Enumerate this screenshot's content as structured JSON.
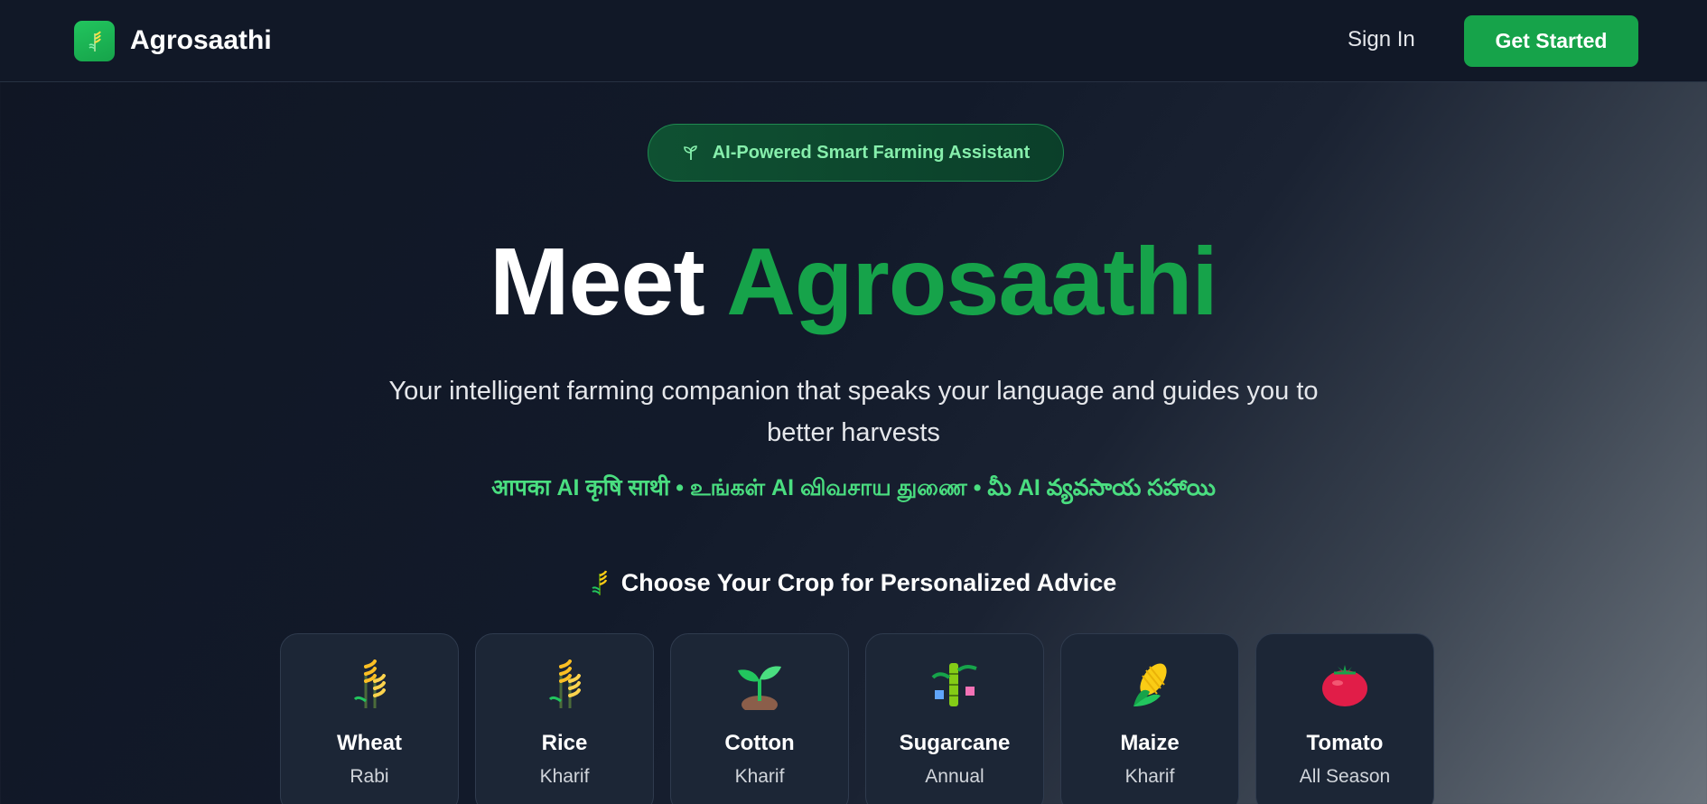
{
  "header": {
    "brand": "Agrosaathi",
    "sign_in": "Sign In",
    "get_started": "Get Started"
  },
  "badge": {
    "text": "AI-Powered Smart Farming Assistant"
  },
  "hero": {
    "title_part1": "Meet",
    "title_part2": "Agrosaathi",
    "subtitle": "Your intelligent farming companion that speaks your language and guides you to better harvests",
    "multilang": "आपका AI कृषि साथी • உங்கள் AI விவசாய துணை • మీ AI వ్యవసాయ సహాయి"
  },
  "crops": {
    "heading": "Choose Your Crop for Personalized Advice",
    "items": [
      {
        "name": "Wheat",
        "season": "Rabi",
        "icon": "wheat-icon"
      },
      {
        "name": "Rice",
        "season": "Kharif",
        "icon": "rice-icon"
      },
      {
        "name": "Cotton",
        "season": "Kharif",
        "icon": "seedling-icon"
      },
      {
        "name": "Sugarcane",
        "season": "Annual",
        "icon": "sugarcane-icon"
      },
      {
        "name": "Maize",
        "season": "Kharif",
        "icon": "corn-icon"
      },
      {
        "name": "Tomato",
        "season": "All Season",
        "icon": "tomato-icon"
      }
    ]
  },
  "colors": {
    "accent": "#16a34a",
    "accent_light": "#4ade80",
    "header_bg": "#111827",
    "card_bg": "#1c2636"
  }
}
